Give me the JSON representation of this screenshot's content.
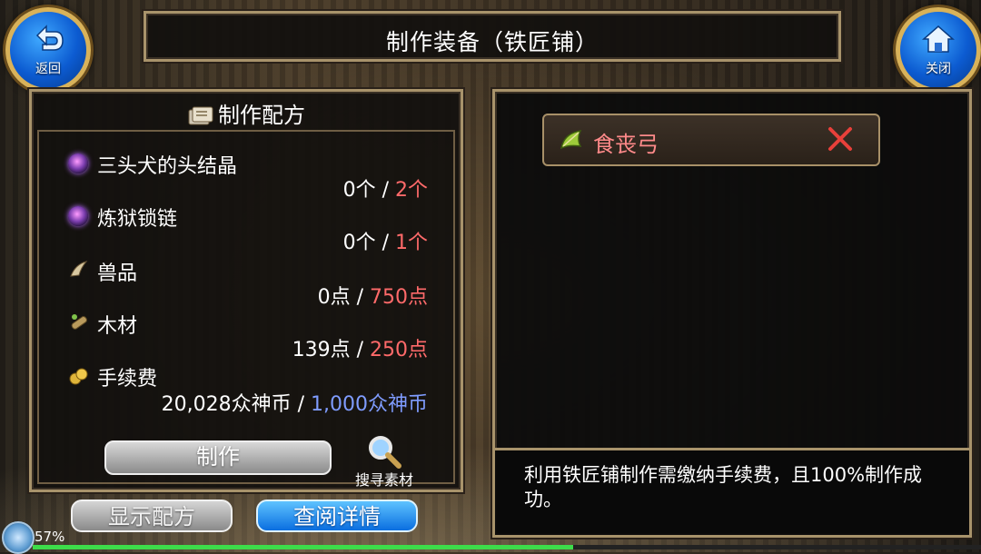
{
  "window": {
    "title": "制作装备（铁匠铺）"
  },
  "nav": {
    "back_label": "返回",
    "close_label": "关闭"
  },
  "recipe": {
    "header": "制作配方",
    "materials": [
      {
        "name": "三头犬的头结晶",
        "have": "0个",
        "sep": " / ",
        "need": "2个",
        "icon": "purple-orb-icon"
      },
      {
        "name": "炼狱锁链",
        "have": "0个",
        "sep": " / ",
        "need": "1个",
        "icon": "purple-orb-icon"
      },
      {
        "name": "兽品",
        "have": "0点",
        "sep": " / ",
        "need": "750点",
        "icon": "claw-icon"
      },
      {
        "name": "木材",
        "have": "139点",
        "sep": " / ",
        "need": "250点",
        "icon": "wood-icon"
      },
      {
        "name": "手续费",
        "have": "20,028众神币",
        "sep": " / ",
        "need": "1,000众神币",
        "icon": "coin-icon"
      }
    ],
    "make_label": "制作",
    "search_label": "搜寻素材"
  },
  "bottom": {
    "show_recipe_label": "显示配方",
    "details_label": "查阅详情"
  },
  "target": {
    "item_name": "食丧弓",
    "icon": "bow-icon"
  },
  "info": {
    "text": "利用铁匠铺制作需缴纳手续费，且100%制作成功。"
  },
  "status": {
    "battery": "57%",
    "progress": 0.57
  },
  "colors": {
    "need_short": "#ff6a6a",
    "need_ok": "#7f9cff",
    "accent_blue": "#0a6ee0",
    "frame": "#a8936b"
  }
}
